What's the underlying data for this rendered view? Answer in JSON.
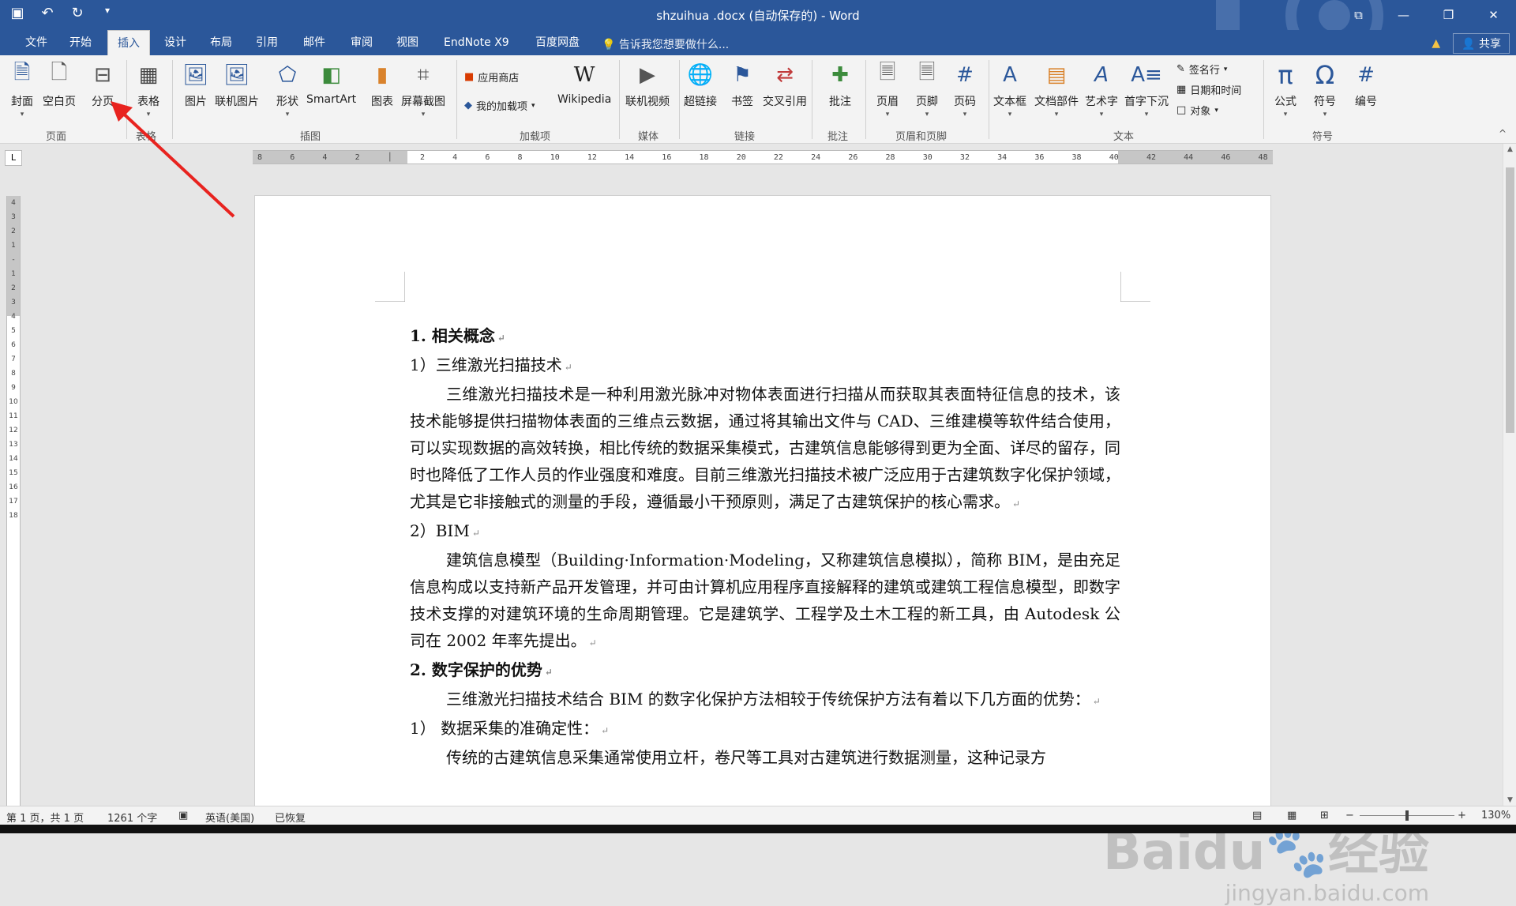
{
  "window": {
    "title": "shzuihua .docx (自动保存的) - Word"
  },
  "tabs": [
    "文件",
    "开始",
    "插入",
    "设计",
    "布局",
    "引用",
    "邮件",
    "审阅",
    "视图",
    "EndNote X9",
    "百度网盘"
  ],
  "active_tab": "插入",
  "tell_me": "告诉我您想要做什么...",
  "share_label": "共享",
  "ribbon": {
    "buttons": {
      "cover": "封面",
      "blank": "空白页",
      "pagebreak": "分页",
      "table": "表格",
      "picture": "图片",
      "online_picture": "联机图片",
      "shapes": "形状",
      "smartart": "SmartArt",
      "chart": "图表",
      "screenshot": "屏幕截图",
      "store": "应用商店",
      "my_addins": "我的加载项",
      "wikipedia": "Wikipedia",
      "online_video": "联机视频",
      "hyperlink": "超链接",
      "bookmark": "书签",
      "crossref": "交叉引用",
      "comment": "批注",
      "header": "页眉",
      "footer": "页脚",
      "page_number": "页码",
      "textbox": "文本框",
      "quickparts": "文档部件",
      "wordart": "艺术字",
      "dropcap": "首字下沉",
      "signature": "签名行",
      "datetime": "日期和时间",
      "object": "对象",
      "equation": "公式",
      "symbol": "符号",
      "number": "编号"
    },
    "groups": {
      "pages": "页面",
      "tables": "表格",
      "illustrations": "插图",
      "addins": "加载项",
      "media": "媒体",
      "links": "链接",
      "comments": "批注",
      "header_footer": "页眉和页脚",
      "text": "文本",
      "symbols": "符号"
    }
  },
  "ruler": {
    "h_ticks": [
      "8",
      "6",
      "4",
      "2",
      "",
      "2",
      "4",
      "6",
      "8",
      "10",
      "12",
      "14",
      "16",
      "18",
      "20",
      "22",
      "24",
      "26",
      "28",
      "30",
      "32",
      "34",
      "36",
      "38",
      "40",
      "42",
      "44",
      "46",
      "48"
    ],
    "v_ticks": [
      "4",
      "3",
      "2",
      "1",
      "",
      "1",
      "2",
      "3",
      "4",
      "5",
      "6",
      "7",
      "8",
      "9",
      "10",
      "11",
      "12",
      "13",
      "14",
      "15",
      "16",
      "17",
      "18"
    ]
  },
  "document": {
    "paragraphs": [
      {
        "style": "h",
        "text": "1. 相关概念"
      },
      {
        "style": "n",
        "text": "1）三维激光扫描技术"
      },
      {
        "style": "ind",
        "text": "三维激光扫描技术是一种利用激光脉冲对物体表面进行扫描从而获取其表面特征信息的技术，该技术能够提供扫描物体表面的三维点云数据，通过将其输出文件与 CAD、三维建模等软件结合使用，可以实现数据的高效转换，相比传统的数据采集模式，古建筑信息能够得到更为全面、详尽的留存，同时也降低了工作人员的作业强度和难度。目前三维激光扫描技术被广泛应用于古建筑数字化保护领域，尤其是它非接触式的测量的手段，遵循最小干预原则，满足了古建筑保护的核心需求。"
      },
      {
        "style": "n",
        "text": "2）BIM"
      },
      {
        "style": "ind",
        "text": "建筑信息模型（Building·Information·Modeling，又称建筑信息模拟），简称 BIM，是由充足信息构成以支持新产品开发管理，并可由计算机应用程序直接解释的建筑或建筑工程信息模型，即数字技术支撑的对建筑环境的生命周期管理。它是建筑学、工程学及土木工程的新工具，由 Autodesk 公司在 2002 年率先提出。"
      },
      {
        "style": "h",
        "text": "2. 数字保护的优势"
      },
      {
        "style": "ind",
        "text": "三维激光扫描技术结合 BIM 的数字化保护方法相较于传统保护方法有着以下几方面的优势："
      },
      {
        "style": "n",
        "text": "1） 数据采集的准确定性："
      },
      {
        "style": "ind",
        "text": "传统的古建筑信息采集通常使用立杆，卷尺等工具对古建筑进行数据测量，这种记录方"
      }
    ]
  },
  "status": {
    "page": "第 1 页，共 1 页",
    "words": "1261 个字",
    "lang": "英语(美国)",
    "recovered": "已恢复",
    "zoom": "130%"
  },
  "watermark": {
    "brand": "Baidu",
    "cn": "经验",
    "url": "jingyan.baidu.com"
  },
  "colors": {
    "accent": "#2b579a",
    "arrow": "#e8231f"
  }
}
